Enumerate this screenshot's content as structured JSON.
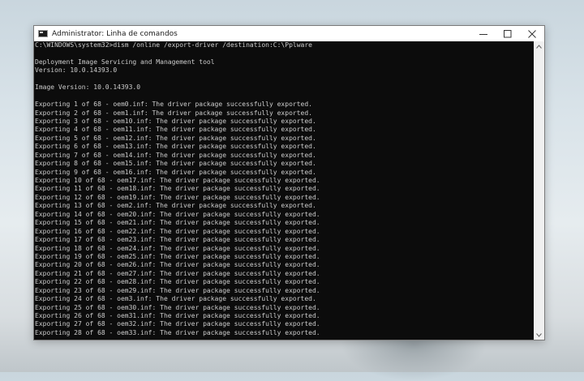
{
  "window": {
    "title": "Administrator: Linha de comandos",
    "icon": "cmd-icon",
    "controls": {
      "minimize": "minimize-icon",
      "maximize": "maximize-icon",
      "close": "close-icon"
    }
  },
  "console": {
    "lines": [
      "C:\\WINDOWS\\system32>dism /online /export-driver /destination:C:\\Pplware",
      "",
      "Deployment Image Servicing and Management tool",
      "Version: 10.0.14393.0",
      "",
      "Image Version: 10.0.14393.0",
      "",
      "Exporting 1 of 68 - oem0.inf: The driver package successfully exported.",
      "Exporting 2 of 68 - oem1.inf: The driver package successfully exported.",
      "Exporting 3 of 68 - oem10.inf: The driver package successfully exported.",
      "Exporting 4 of 68 - oem11.inf: The driver package successfully exported.",
      "Exporting 5 of 68 - oem12.inf: The driver package successfully exported.",
      "Exporting 6 of 68 - oem13.inf: The driver package successfully exported.",
      "Exporting 7 of 68 - oem14.inf: The driver package successfully exported.",
      "Exporting 8 of 68 - oem15.inf: The driver package successfully exported.",
      "Exporting 9 of 68 - oem16.inf: The driver package successfully exported.",
      "Exporting 10 of 68 - oem17.inf: The driver package successfully exported.",
      "Exporting 11 of 68 - oem18.inf: The driver package successfully exported.",
      "Exporting 12 of 68 - oem19.inf: The driver package successfully exported.",
      "Exporting 13 of 68 - oem2.inf: The driver package successfully exported.",
      "Exporting 14 of 68 - oem20.inf: The driver package successfully exported.",
      "Exporting 15 of 68 - oem21.inf: The driver package successfully exported.",
      "Exporting 16 of 68 - oem22.inf: The driver package successfully exported.",
      "Exporting 17 of 68 - oem23.inf: The driver package successfully exported.",
      "Exporting 18 of 68 - oem24.inf: The driver package successfully exported.",
      "Exporting 19 of 68 - oem25.inf: The driver package successfully exported.",
      "Exporting 20 of 68 - oem26.inf: The driver package successfully exported.",
      "Exporting 21 of 68 - oem27.inf: The driver package successfully exported.",
      "Exporting 22 of 68 - oem28.inf: The driver package successfully exported.",
      "Exporting 23 of 68 - oem29.inf: The driver package successfully exported.",
      "Exporting 24 of 68 - oem3.inf: The driver package successfully exported.",
      "Exporting 25 of 68 - oem30.inf: The driver package successfully exported.",
      "Exporting 26 of 68 - oem31.inf: The driver package successfully exported.",
      "Exporting 27 of 68 - oem32.inf: The driver package successfully exported.",
      "Exporting 28 of 68 - oem33.inf: The driver package successfully exported."
    ]
  },
  "colors": {
    "console_bg": "#0c0c0c",
    "console_fg": "#cccccc",
    "titlebar_bg": "#ffffff"
  }
}
